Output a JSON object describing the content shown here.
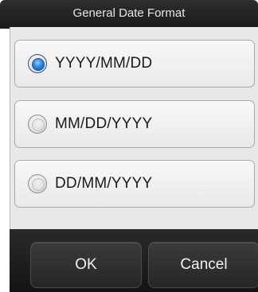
{
  "dialog": {
    "title": "General Date Format",
    "options": [
      {
        "label": "YYYY/MM/DD",
        "selected": true
      },
      {
        "label": "MM/DD/YYYY",
        "selected": false
      },
      {
        "label": "DD/MM/YYYY",
        "selected": false
      }
    ],
    "buttons": {
      "ok_label": "OK",
      "cancel_label": "Cancel"
    }
  },
  "colors": {
    "title_bar": "#1f1f1f",
    "content_bg": "#e8e8e8",
    "radio_selected": "#2f86e6",
    "footer_bg": "#1c1c1c"
  },
  "icons": {
    "selected_radio": "radio-selected-icon",
    "unselected_radio": "radio-unselected-icon"
  }
}
